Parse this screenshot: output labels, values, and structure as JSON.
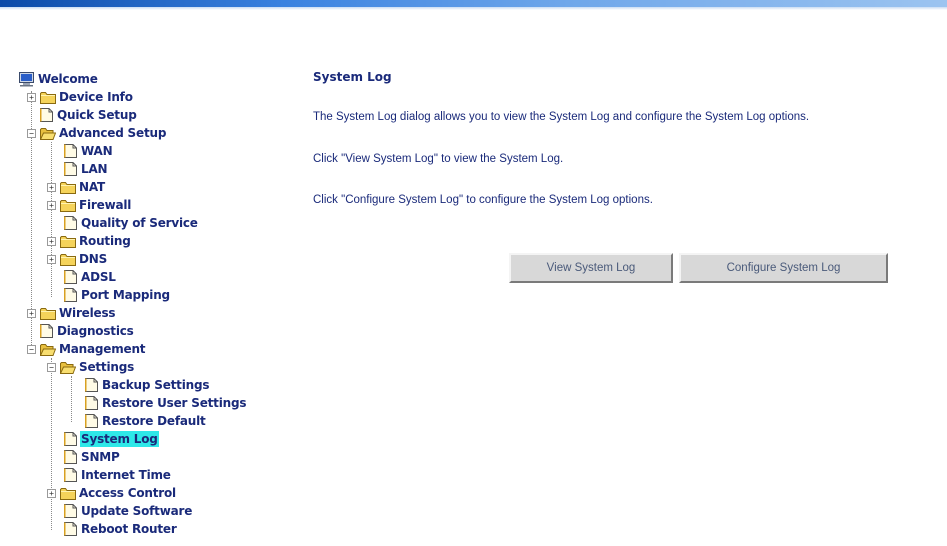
{
  "nav": {
    "welcome": "Welcome",
    "device_info": "Device Info",
    "quick_setup": "Quick Setup",
    "advanced_setup": "Advanced Setup",
    "wan": "WAN",
    "lan": "LAN",
    "nat": "NAT",
    "firewall": "Firewall",
    "qos": "Quality of Service",
    "routing": "Routing",
    "dns": "DNS",
    "adsl": "ADSL",
    "port_mapping": "Port Mapping",
    "wireless": "Wireless",
    "diagnostics": "Diagnostics",
    "management": "Management",
    "settings": "Settings",
    "backup_settings": "Backup Settings",
    "restore_user_settings": "Restore User Settings",
    "restore_default": "Restore Default",
    "system_log": "System Log",
    "snmp": "SNMP",
    "internet_time": "Internet Time",
    "access_control": "Access Control",
    "update_software": "Update Software",
    "reboot_router": "Reboot Router"
  },
  "main": {
    "title": "System Log",
    "description": "The System Log dialog allows you to view the System Log and configure the System Log options.",
    "view_hint": "Click \"View System Log\" to view the System Log.",
    "configure_hint": "Click \"Configure System Log\" to configure the System Log options.",
    "view_button": "View System Log",
    "configure_button": "Configure System Log"
  },
  "colors": {
    "accent": "#1a2a7a",
    "selection": "#2ee8e8",
    "folder": "#f5d35a",
    "button_face": "#d8d8d8"
  }
}
